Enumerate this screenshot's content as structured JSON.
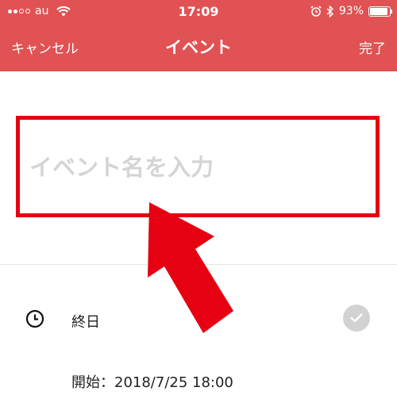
{
  "status_bar": {
    "carrier": "au",
    "time": "17:09",
    "battery": "93%",
    "battery_level": 0.93
  },
  "nav": {
    "cancel_label": "キャンセル",
    "title": "イベント",
    "done_label": "完了"
  },
  "event_form": {
    "name_placeholder": "イベント名を入力",
    "name_value": "",
    "all_day_label": "終日",
    "start_label": "開始：2018/7/25 18:00"
  },
  "colors": {
    "header": "#e05253",
    "highlight": "#e50012",
    "toggle": "#d2d2d2"
  },
  "icons": [
    "wifi-icon",
    "alarm-icon",
    "bluetooth-icon",
    "battery-icon",
    "clock-icon",
    "check-icon",
    "arrow-annotation"
  ]
}
